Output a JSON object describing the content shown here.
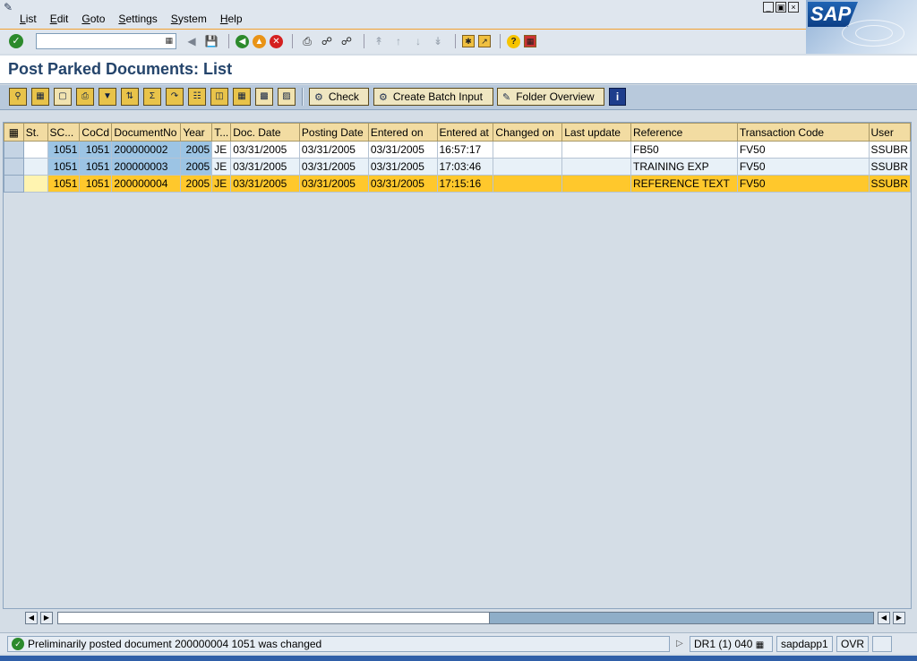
{
  "menu": {
    "items": [
      "List",
      "Edit",
      "Goto",
      "Settings",
      "System",
      "Help"
    ]
  },
  "logo": {
    "text": "SAP"
  },
  "command_field": {
    "value": ""
  },
  "title": "Post Parked Documents: List",
  "app_toolbar": {
    "check_label": "Check",
    "batch_label": "Create Batch Input",
    "folder_label": "Folder Overview",
    "info_label": "i"
  },
  "grid": {
    "columns": [
      "St.",
      "SC...",
      "CoCd",
      "DocumentNo",
      "Year",
      "T...",
      "Doc. Date",
      "Posting Date",
      "Entered on",
      "Entered at",
      "Changed on",
      "Last update",
      "Reference",
      "Transaction Code",
      "User"
    ],
    "rows": [
      [
        "",
        "1051",
        "1051",
        "200000002",
        "2005",
        "JE",
        "03/31/2005",
        "03/31/2005",
        "03/31/2005",
        "16:57:17",
        "",
        "",
        "FB50",
        "FV50",
        "SSUBR"
      ],
      [
        "",
        "1051",
        "1051",
        "200000003",
        "2005",
        "JE",
        "03/31/2005",
        "03/31/2005",
        "03/31/2005",
        "17:03:46",
        "",
        "",
        "TRAINING EXP",
        "FV50",
        "SSUBR"
      ],
      [
        "",
        "1051",
        "1051",
        "200000004",
        "2005",
        "JE",
        "03/31/2005",
        "03/31/2005",
        "03/31/2005",
        "17:15:16",
        "",
        "",
        "REFERENCE TEXT",
        "FV50",
        "SSUBR"
      ]
    ],
    "selected_row": 2
  },
  "status": {
    "message": "Preliminarily posted document 200000004 1051 was changed",
    "system": "DR1 (1) 040",
    "server": "sapdapp1",
    "mode": "OVR"
  },
  "colors": {
    "title": "#24446b",
    "header_bg": "#f2dca2",
    "selected_row": "#ffc82c",
    "key_col": "#9cc4e4"
  }
}
